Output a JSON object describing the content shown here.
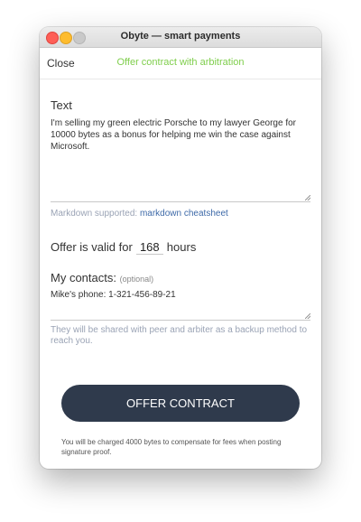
{
  "window": {
    "title": "Obyte — smart payments"
  },
  "nav": {
    "close_label": "Close",
    "title": "Offer contract with arbitration"
  },
  "form": {
    "text_label": "Text",
    "text_value": "I'm selling my green electric Porsche to my lawyer George for 10000 bytes as a bonus for helping me win the case against Microsoft.",
    "markdown_hint": "Markdown supported:",
    "markdown_link": "markdown cheatsheet",
    "offer_prefix": "Offer is valid for",
    "hours_value": "168",
    "hours_suffix": "hours",
    "contacts_label": "My contacts:",
    "contacts_optional": "(optional)",
    "contacts_value": "Mike's phone: 1-321-456-89-21",
    "contacts_hint": "They will be shared with peer and arbiter as a backup method to reach you.",
    "submit_label": "OFFER CONTRACT",
    "fee_note": "You will be charged 4000 bytes to compensate for fees when posting signature proof."
  },
  "colors": {
    "accent": "#7fce4c",
    "button": "#2f3a4c",
    "link": "#3e6aa8"
  }
}
